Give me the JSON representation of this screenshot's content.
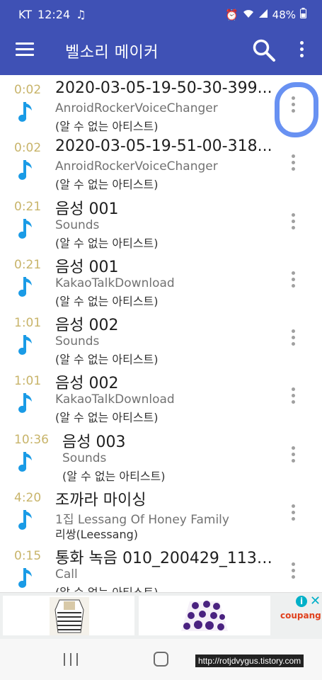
{
  "status_bar": {
    "carrier": "KT",
    "time": "12:24",
    "battery": "48%"
  },
  "app_bar": {
    "title": "벨소리 메이커"
  },
  "songs": [
    {
      "duration": "0:02",
      "title": "2020-03-05-19-50-30-399...",
      "album": "AnroidRockerVoiceChanger",
      "artist": "(알 수 없는 아티스트)"
    },
    {
      "duration": "0:02",
      "title": "2020-03-05-19-51-00-318...",
      "album": "AnroidRockerVoiceChanger",
      "artist": "(알 수 없는 아티스트)"
    },
    {
      "duration": "0:21",
      "title": "음성 001",
      "album": "Sounds",
      "artist": "(알 수 없는 아티스트)"
    },
    {
      "duration": "0:21",
      "title": "음성 001",
      "album": "KakaoTalkDownload",
      "artist": "(알 수 없는 아티스트)"
    },
    {
      "duration": "1:01",
      "title": "음성 002",
      "album": "Sounds",
      "artist": "(알 수 없는 아티스트)"
    },
    {
      "duration": "1:01",
      "title": "음성 002",
      "album": "KakaoTalkDownload",
      "artist": "(알 수 없는 아티스트)"
    },
    {
      "duration": "10:36",
      "title": "음성 003",
      "album": "Sounds",
      "artist": "(알 수 없는 아티스트)"
    },
    {
      "duration": "4:20",
      "title": "조까라 마이싱",
      "album": "1집 Lessang Of Honey Family",
      "artist": "리쌍(Leessang)"
    },
    {
      "duration": "0:15",
      "title": "통화 녹음 010_200429_1130...",
      "album": "Call",
      "artist": "(알 수 없는 아티스트)"
    }
  ],
  "ad": {
    "info_label": "i",
    "close_label": "✕",
    "brand": "coupang"
  },
  "watermark": "http://rotjdvygus.tistory.com",
  "colors": {
    "primary": "#3f51b5",
    "note_icon": "#1a9be6",
    "duration": "#c8b46a",
    "highlight": "#4d7ef0"
  },
  "icons": {
    "menu": "hamburger-icon",
    "search": "search-icon",
    "more": "more-vert-icon",
    "row": "music-note-icon"
  }
}
